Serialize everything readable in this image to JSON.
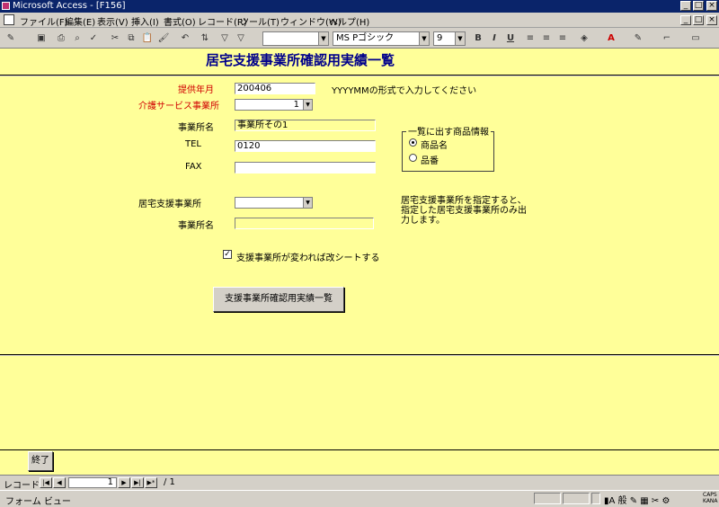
{
  "window": {
    "title": "Microsoft Access - [F156]",
    "controls": [
      "_",
      "□",
      "×"
    ]
  },
  "menu": {
    "items": [
      "ファイル(F)",
      "編集(E)",
      "表示(V)",
      "挿入(I)",
      "書式(O)",
      "レコード(R)",
      "ツール(T)",
      "ウィンドウ(W)",
      "ヘルプ(H)"
    ]
  },
  "toolbar": {
    "font_name": "MS Pゴシック",
    "font_size": "9",
    "bold": "B",
    "italic": "I",
    "underline": "U"
  },
  "form": {
    "title": "居宅支援事業所確認用実績一覧",
    "fields": {
      "year_month_label": "提供年月",
      "year_month_value": "200406",
      "year_month_hint": "YYYYMMの形式で入力してください",
      "service_office_label": "介護サービス事業所",
      "service_office_value": "1",
      "office_name_label": "事業所名",
      "office_name_value": "事業所その1",
      "tel_label": "TEL",
      "tel_value": "0120",
      "fax_label": "FAX",
      "fax_value": "",
      "care_office_label": "居宅支援事業所",
      "care_office_value": "",
      "care_office_name_label": "事業所名",
      "care_office_name_value": "",
      "care_office_note": "居宅支援事業所を指定すると、指定した居宅支援事業所のみ出力します。"
    },
    "product_group": {
      "title": "一覧に出す商品情報",
      "options": [
        "商品名",
        "品番"
      ],
      "selected": "商品名"
    },
    "checkbox_label": "支援事業所が変われば改シートする",
    "report_button": "支援事業所確認用実績一覧",
    "close_button": "終了"
  },
  "nav": {
    "label": "レコード:",
    "current": "1",
    "total": "/ 1"
  },
  "status": {
    "text": "フォーム ビュー",
    "caps": "CAPS",
    "kana": "KANA"
  },
  "colors": {
    "form_bg": "#ffff99",
    "title": "#00008b",
    "required_label": "#d00000"
  }
}
